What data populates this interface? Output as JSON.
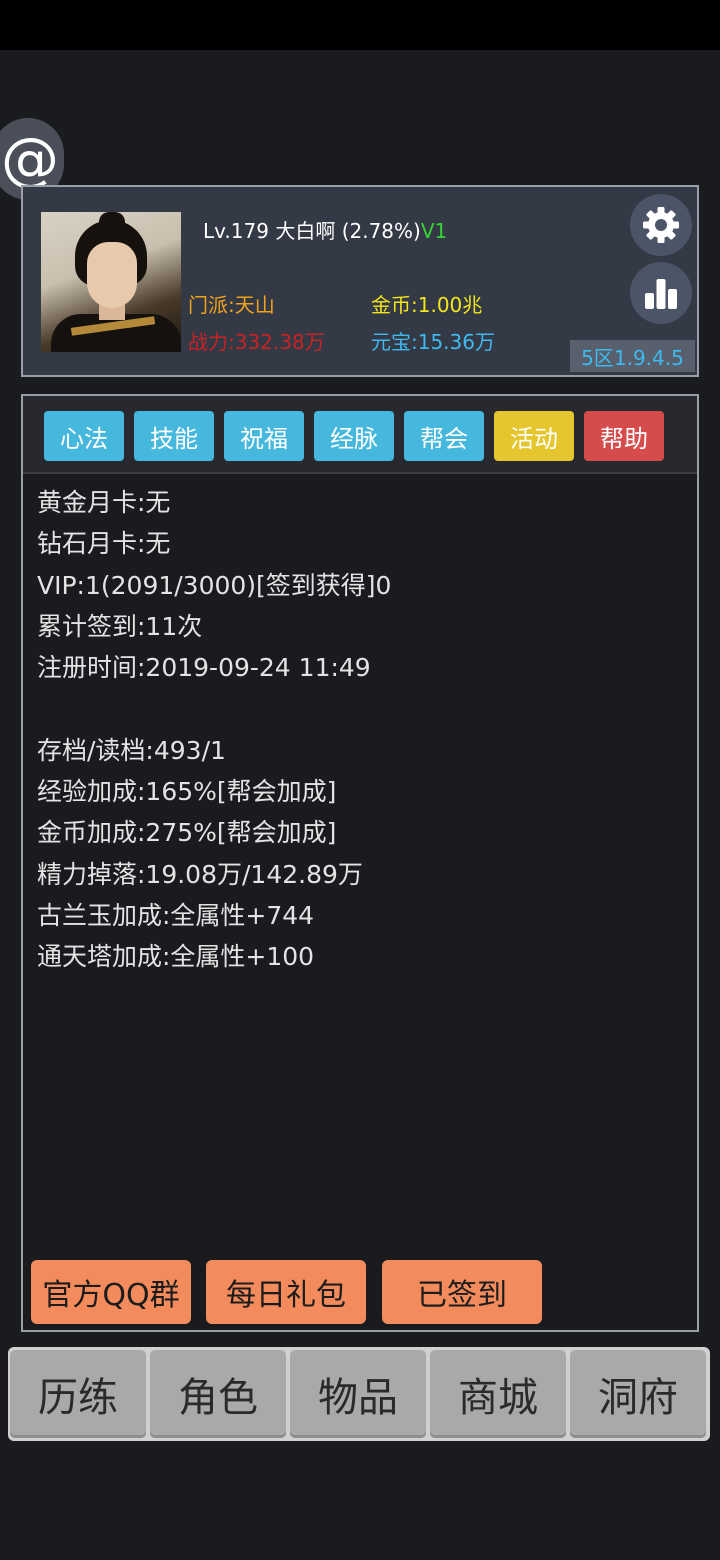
{
  "profile": {
    "level": "Lv.179",
    "name": "大白啊",
    "exp_percent": "(2.78%)",
    "vip_badge": "V1",
    "sect": "门派:天山",
    "power": "战力:332.38万",
    "gold": "金币:1.00兆",
    "ingot": "元宝:15.36万",
    "version": "5区1.9.4.5"
  },
  "icons": {
    "at": "at-sign-icon",
    "settings": "gear-icon",
    "stats": "bar-chart-icon"
  },
  "tabs": [
    {
      "label": "心法",
      "color": "#47b8dd"
    },
    {
      "label": "技能",
      "color": "#47b8dd"
    },
    {
      "label": "祝福",
      "color": "#47b8dd"
    },
    {
      "label": "经脉",
      "color": "#47b8dd"
    },
    {
      "label": "帮会",
      "color": "#47b8dd"
    },
    {
      "label": "活动",
      "color": "#e6c62f"
    },
    {
      "label": "帮助",
      "color": "#d64b4b"
    }
  ],
  "info": [
    "黄金月卡:无",
    "钻石月卡:无",
    "VIP:1(2091/3000)[签到获得]0",
    "累计签到:11次",
    "注册时间:2019-09-24 11:49",
    "",
    "存档/读档:493/1",
    "经验加成:165%[帮会加成]",
    "金币加成:275%[帮会加成]",
    "精力掉落:19.08万/142.89万",
    "古兰玉加成:全属性+744",
    "通天塔加成:全属性+100"
  ],
  "actions": {
    "qq_group": "官方QQ群",
    "daily_gift": "每日礼包",
    "signed_in": "已签到"
  },
  "nav": [
    "历练",
    "角色",
    "物品",
    "商城",
    "洞府"
  ]
}
